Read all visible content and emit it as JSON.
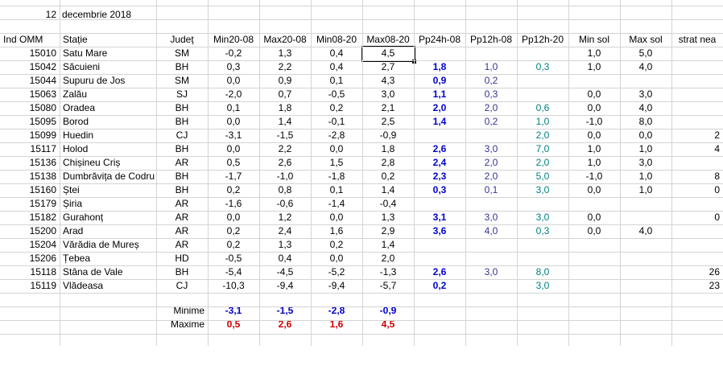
{
  "date": {
    "day": "12",
    "text": "decembrie 2018"
  },
  "headers": [
    "Ind OMM",
    "Stație",
    "Județ",
    "Min20-08",
    "Max20-08",
    "Min08-20",
    "Max08-20",
    "Pp24h-08",
    "Pp12h-08",
    "Pp12h-20",
    "Min sol",
    "Max sol",
    "strat nea"
  ],
  "rows": [
    [
      "15010",
      "Satu Mare",
      "SM",
      "-0,2",
      "1,3",
      "0,4",
      "4,5",
      "",
      "",
      "",
      "1,0",
      "5,0",
      ""
    ],
    [
      "15042",
      "Săcuieni",
      "BH",
      "0,3",
      "2,2",
      "0,4",
      "2,7",
      "1,8",
      "1,0",
      "0,3",
      "1,0",
      "4,0",
      ""
    ],
    [
      "15044",
      "Supuru de Jos",
      "SM",
      "0,0",
      "0,9",
      "0,1",
      "4,3",
      "0,9",
      "0,2",
      "",
      "",
      "",
      ""
    ],
    [
      "15063",
      "Zalău",
      "SJ",
      "-2,0",
      "0,7",
      "-0,5",
      "3,0",
      "1,1",
      "0,3",
      "",
      "0,0",
      "3,0",
      ""
    ],
    [
      "15080",
      "Oradea",
      "BH",
      "0,1",
      "1,8",
      "0,2",
      "2,1",
      "2,0",
      "2,0",
      "0,6",
      "0,0",
      "4,0",
      ""
    ],
    [
      "15095",
      "Borod",
      "BH",
      "0,0",
      "1,4",
      "-0,1",
      "2,5",
      "1,4",
      "0,2",
      "1,0",
      "-1,0",
      "8,0",
      ""
    ],
    [
      "15099",
      "Huedin",
      "CJ",
      "-3,1",
      "-1,5",
      "-2,8",
      "-0,9",
      "",
      "",
      "2,0",
      "0,0",
      "0,0",
      "2"
    ],
    [
      "15117",
      "Holod",
      "BH",
      "0,0",
      "2,2",
      "0,0",
      "1,8",
      "2,6",
      "3,0",
      "7,0",
      "1,0",
      "1,0",
      "4"
    ],
    [
      "15136",
      "Chișineu    Criș",
      "AR",
      "0,5",
      "2,6",
      "1,5",
      "2,8",
      "2,4",
      "2,0",
      "2,0",
      "1,0",
      "3,0",
      ""
    ],
    [
      "15138",
      "Dumbrăvița de Codru",
      "BH",
      "-1,7",
      "-1,0",
      "-1,8",
      "0,2",
      "2,3",
      "2,0",
      "5,0",
      "-1,0",
      "1,0",
      "8"
    ],
    [
      "15160",
      "Ștei",
      "BH",
      "0,2",
      "0,8",
      "0,1",
      "1,4",
      "0,3",
      "0,1",
      "3,0",
      "0,0",
      "1,0",
      "0"
    ],
    [
      "15179",
      "Șiria",
      "AR",
      "-1,6",
      "-0,6",
      "-1,4",
      "-0,4",
      "",
      "",
      "",
      "",
      "",
      ""
    ],
    [
      "15182",
      "Gurahonț",
      "AR",
      "0,0",
      "1,2",
      "0,0",
      "1,3",
      "3,1",
      "3,0",
      "3,0",
      "0,0",
      "",
      "0"
    ],
    [
      "15200",
      "Arad",
      "AR",
      "0,2",
      "2,4",
      "1,6",
      "2,9",
      "3,6",
      "4,0",
      "0,3",
      "0,0",
      "4,0",
      ""
    ],
    [
      "15204",
      "Vărădia de Mureș",
      "AR",
      "0,2",
      "1,3",
      "0,2",
      "1,4",
      "",
      "",
      "",
      "",
      "",
      ""
    ],
    [
      "15206",
      "Țebea",
      "HD",
      "-0,5",
      "0,4",
      "0,0",
      "2,0",
      "",
      "",
      "",
      "",
      "",
      ""
    ]
  ],
  "mountain_rows": [
    [
      "15118",
      "Stâna de Vale",
      "BH",
      "-5,4",
      "-4,5",
      "-5,2",
      "-1,3",
      "2,6",
      "3,0",
      "8,0",
      "",
      "",
      "26"
    ],
    [
      "15119",
      "Vlădeasa",
      "CJ",
      "-10,3",
      "-9,4",
      "-9,4",
      "-5,7",
      "0,2",
      "",
      "3,0",
      "",
      "",
      "23"
    ]
  ],
  "summary": {
    "min_label": "Minime",
    "max_label": "Maxime",
    "min_values": [
      "-3,1",
      "-1,5",
      "-2,8",
      "-0,9"
    ],
    "max_values": [
      "0,5",
      "2,6",
      "1,6",
      "4,5"
    ]
  },
  "colors": {
    "pp24": "#0000cc",
    "pp12_08": "#333399",
    "pp12_20": "#008080",
    "max": "#cc0000",
    "grid": "#d4d4d4"
  }
}
